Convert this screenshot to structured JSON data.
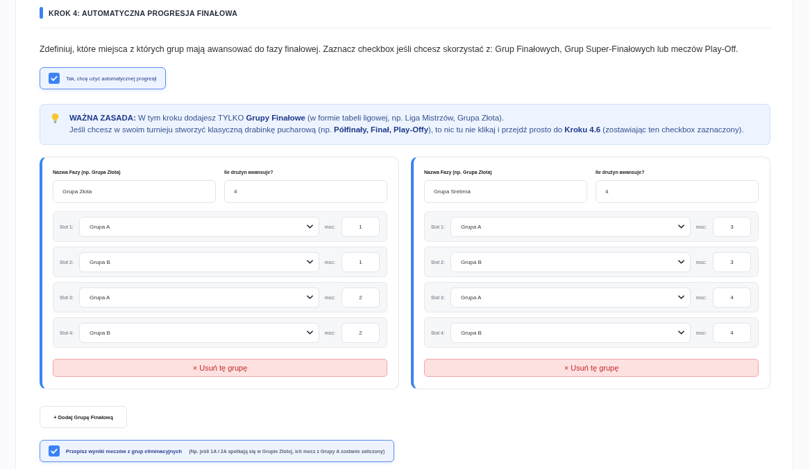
{
  "step": {
    "title": "KROK 4: AUTOMATYCZNA PROGRESJA FINAŁOWA"
  },
  "intro": "Zdefiniuj, które miejsca z których grup mają awansować do fazy finałowej. Zaznacz checkbox jeśli chcesz skorzystać z: Grup Finałowych, Grup Super-Finałowych lub meczów Play-Off.",
  "auto_progression": {
    "label": "Tak, chcę użyć automatycznej progresji",
    "checked": true
  },
  "info": {
    "lines": [
      "**WAŻNA ZASADA:** W tym kroku dodajesz TYLKO **Grupy Finałowe** (w formie tabeli ligowej, np. Liga Mistrzów, Grupa Złota).",
      "Jeśli chcesz w swoim turnieju stworzyć klasyczną drabinkę pucharową (np. **Półfinały, Finał, Play-Offy**), to nic tu nie klikaj i przejdź prosto do **Kroku 4.6** (zostawiając ten checkbox zaznaczony)."
    ]
  },
  "groups": [
    {
      "name_label": "Nazwa Fazy (np. Grupa Złota)",
      "name": "Grupa Złota",
      "count_label": "Ile drużyn awansuje?",
      "count": "4",
      "slots": [
        {
          "label": "Slot 1:",
          "group": "Grupa A",
          "place_label": "msc:",
          "place": "1"
        },
        {
          "label": "Slot 2:",
          "group": "Grupa B",
          "place_label": "msc:",
          "place": "1"
        },
        {
          "label": "Slot 3:",
          "group": "Grupa A",
          "place_label": "msc:",
          "place": "2"
        },
        {
          "label": "Slot 4:",
          "group": "Grupa B",
          "place_label": "msc:",
          "place": "2"
        }
      ],
      "remove_button": "× Usuń tę grupę"
    },
    {
      "name_label": "Nazwa Fazy (np. Grupa Złota)",
      "name": "Grupa Srebrna",
      "count_label": "Ile drużyn awansuje?",
      "count": "4",
      "slots": [
        {
          "label": "Slot 1:",
          "group": "Grupa A",
          "place_label": "msc:",
          "place": "3"
        },
        {
          "label": "Slot 2:",
          "group": "Grupa B",
          "place_label": "msc:",
          "place": "3"
        },
        {
          "label": "Slot 3:",
          "group": "Grupa A",
          "place_label": "msc:",
          "place": "4"
        },
        {
          "label": "Slot 4:",
          "group": "Grupa B",
          "place_label": "msc:",
          "place": "4"
        }
      ],
      "remove_button": "× Usuń tę grupę"
    }
  ],
  "add_button": "+ Dodaj Grupę Finałową",
  "copy_results": {
    "label": "Przepisz wyniki meczów z grup eliminacyjnych",
    "note": "(Np. jeśli 1A i 2A spotkają się w Grupie Złotej, ich mecz z Grupy A zostanie zaliczony)",
    "checked": true
  }
}
